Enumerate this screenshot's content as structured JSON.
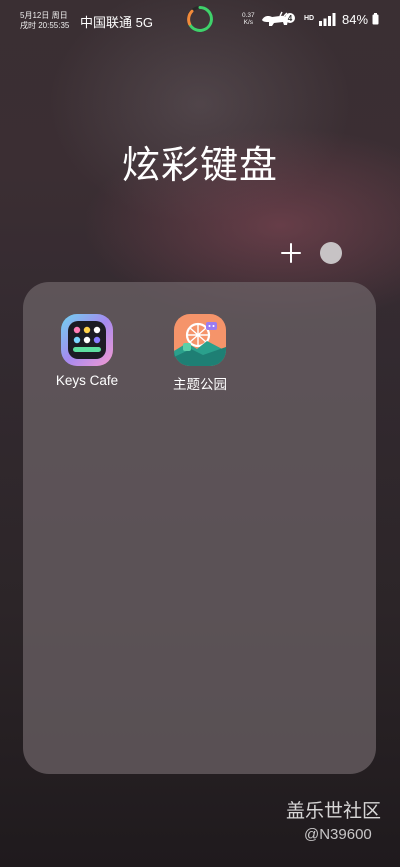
{
  "status_bar": {
    "date": "5月12日 周日",
    "time": "戌时 20:55:35",
    "carrier": "中国联通 5G",
    "net_speed_value": "0.37",
    "net_speed_unit": "K/s",
    "hd_label": "HD",
    "battery": "84%",
    "icons": [
      "activity-ring-icon",
      "bull-icon",
      "signal-icon",
      "battery-icon"
    ]
  },
  "folder": {
    "title": "炫彩键盘",
    "apps": [
      {
        "label": "Keys Cafe",
        "icon": "keys-cafe-icon"
      },
      {
        "label": "主题公园",
        "icon": "theme-park-icon"
      }
    ]
  },
  "watermark": {
    "title": "盖乐世社区",
    "user": "@N39600"
  },
  "colors": {
    "ring_green": "#3fd16b",
    "ring_orange": "#f28a3a",
    "panel": "#6e6468"
  }
}
